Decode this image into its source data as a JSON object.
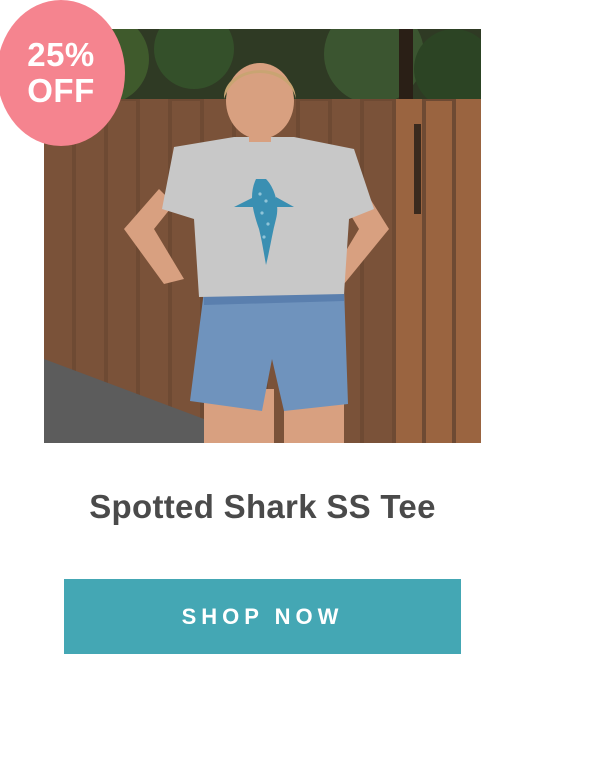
{
  "badge": {
    "line1": "25%",
    "line2": "OFF",
    "color": "#f5848f"
  },
  "product": {
    "title": "Spotted Shark SS Tee",
    "image_alt": "Woman wearing a grey tee with a blue spotted shark print and denim shorts, standing in front of a wooden fence"
  },
  "cta": {
    "label": "SHOP NOW",
    "color": "#44a7b4"
  },
  "colors": {
    "title_text": "#4a4a4a",
    "background": "#ffffff"
  }
}
